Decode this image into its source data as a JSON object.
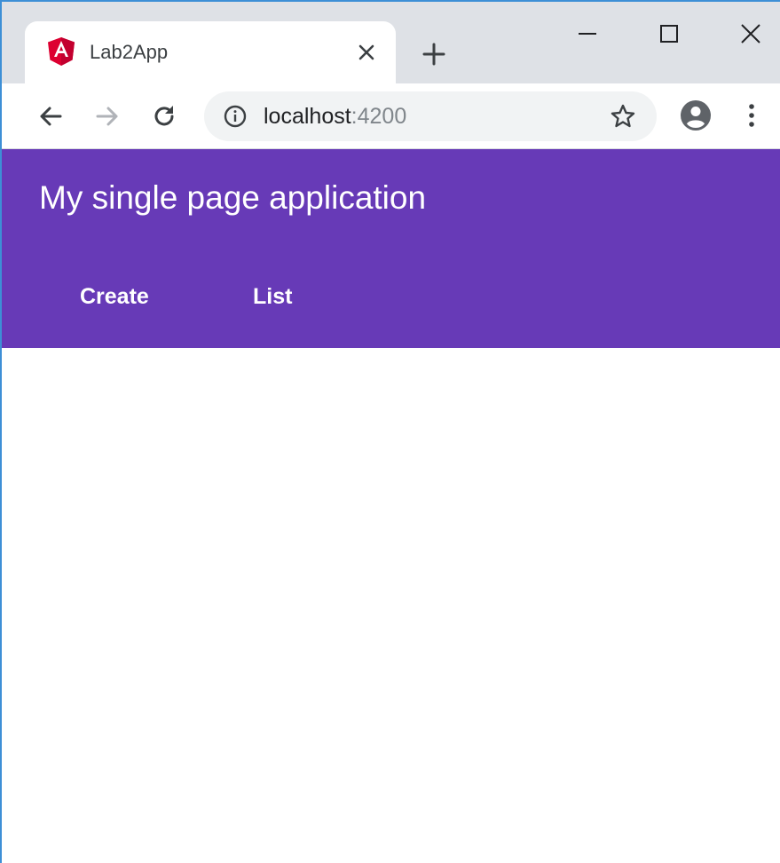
{
  "browser": {
    "tab": {
      "title": "Lab2App",
      "favicon": "angular-logo-icon"
    },
    "address": {
      "host": "localhost",
      "port": ":4200"
    },
    "icons": {
      "back": "arrow-left-icon",
      "forward": "arrow-right-icon",
      "reload": "reload-icon",
      "info": "info-icon",
      "star": "star-icon",
      "profile": "account-circle-icon",
      "menu": "more-vertical-icon",
      "close_tab": "close-icon",
      "new_tab": "plus-icon"
    }
  },
  "app": {
    "title": "My single page application",
    "nav": [
      {
        "label": "Create"
      },
      {
        "label": "List"
      }
    ]
  },
  "colors": {
    "primary": "#673ab7",
    "angular_red": "#dd0031",
    "tabstrip": "#dee1e6",
    "omnibox": "#f1f3f4"
  }
}
